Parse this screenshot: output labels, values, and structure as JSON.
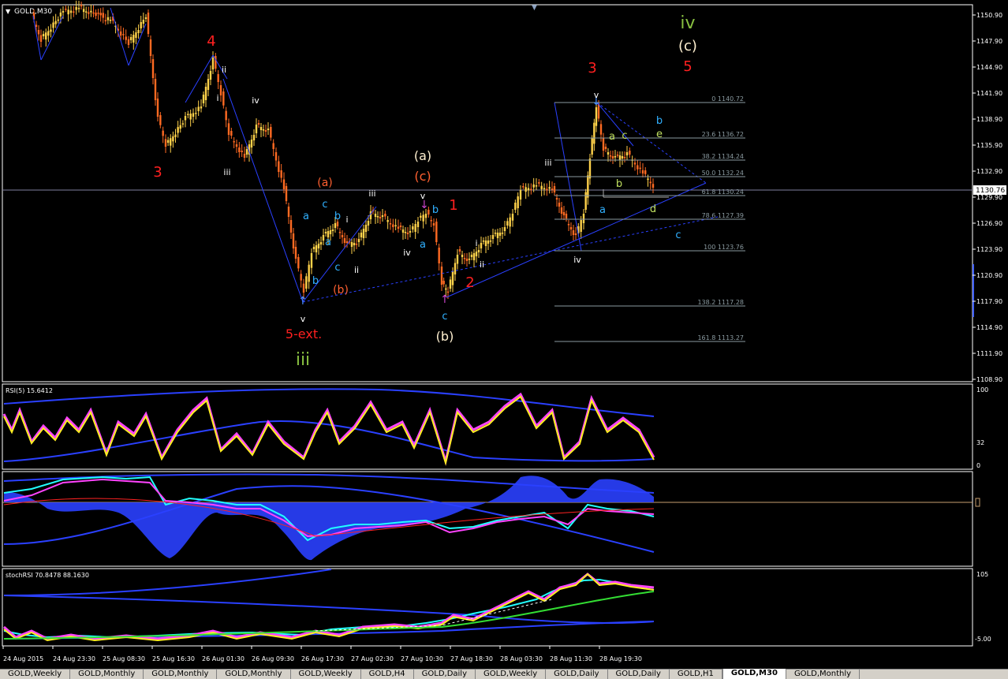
{
  "symbol_label": "GOLD,M30",
  "colors": {
    "bg": "#000000",
    "axis": "#ffffff",
    "candle_up": "#ffd24a",
    "candle_dn": "#ff6a22",
    "trend": "#2a40ff"
  },
  "price_axis": {
    "ticks": [
      "1150.90",
      "1147.90",
      "1144.90",
      "1141.90",
      "1138.90",
      "1135.90",
      "1132.90",
      "1129.90",
      "1126.90",
      "1123.90",
      "1120.90",
      "1117.90",
      "1114.90",
      "1111.90",
      "1108.90"
    ],
    "current_price": "1130.76"
  },
  "wave_labels": {
    "iv_top": "iv",
    "c_top": "(c)",
    "five_top": "5",
    "three_top": "3",
    "red4": "4",
    "red3": "3",
    "ii_a": "ii",
    "i_a": "i",
    "iii_a": "iii",
    "iv_a": "iv",
    "paren_a": "(a)",
    "c1": "c",
    "b1": "b",
    "a1": "a",
    "i_b": "i",
    "iii_b": "iii",
    "a2": "a",
    "b2": "b",
    "c2": "c",
    "b3": "b",
    "ii_b": "ii",
    "paren_b_small": "(b)",
    "v1": "v",
    "five_ext": "5-ext.",
    "iii_green": "iii",
    "paren_a_w": "(a)",
    "paren_c_o": "(c)",
    "v2": "v",
    "b4": "b",
    "a3": "a",
    "iv_b": "iv",
    "c3": "c",
    "paren_b_w": "(b)",
    "one_red": "1",
    "two_red": "2",
    "i_c": "i",
    "ii_c": "ii",
    "iii_c": "iii",
    "iv_c": "iv",
    "a4": "a",
    "v3": "v",
    "b5": "b",
    "e1": "e",
    "a5": "a",
    "c5": "c",
    "b6": "b",
    "d1": "d",
    "c6": "c"
  },
  "fib_levels": [
    "0 1140.72",
    "23.6 1136.72",
    "38.2 1134.24",
    "50.0 1132.24",
    "61.8 1130.24",
    "78.6 1127.39",
    "100 1123.76",
    "138.2 1117.28",
    "161.8 1113.27"
  ],
  "rsi": {
    "title": "RSI(5) 15.6412",
    "ticks": [
      "100",
      "32",
      "0"
    ]
  },
  "stoch": {
    "title": "stochRSI 70.8478 88.1630",
    "ticks": [
      "105",
      "-5.00"
    ]
  },
  "time_axis": [
    "24 Aug 2015",
    "24 Aug 23:30",
    "25 Aug 08:30",
    "25 Aug 16:30",
    "26 Aug 01:30",
    "26 Aug 09:30",
    "26 Aug 17:30",
    "27 Aug 02:30",
    "27 Aug 10:30",
    "27 Aug 18:30",
    "28 Aug 03:30",
    "28 Aug 11:30",
    "28 Aug 19:30"
  ],
  "tabs": [
    "GOLD,Weekly",
    "GOLD,Monthly",
    "GOLD,Monthly",
    "GOLD,Monthly",
    "GOLD,Weekly",
    "GOLD,H4",
    "GOLD,Daily",
    "GOLD,Weekly",
    "GOLD,Daily",
    "GOLD,Daily",
    "GOLD,H1",
    "GOLD,M30",
    "GOLD,Monthly"
  ],
  "active_tab": 11
}
